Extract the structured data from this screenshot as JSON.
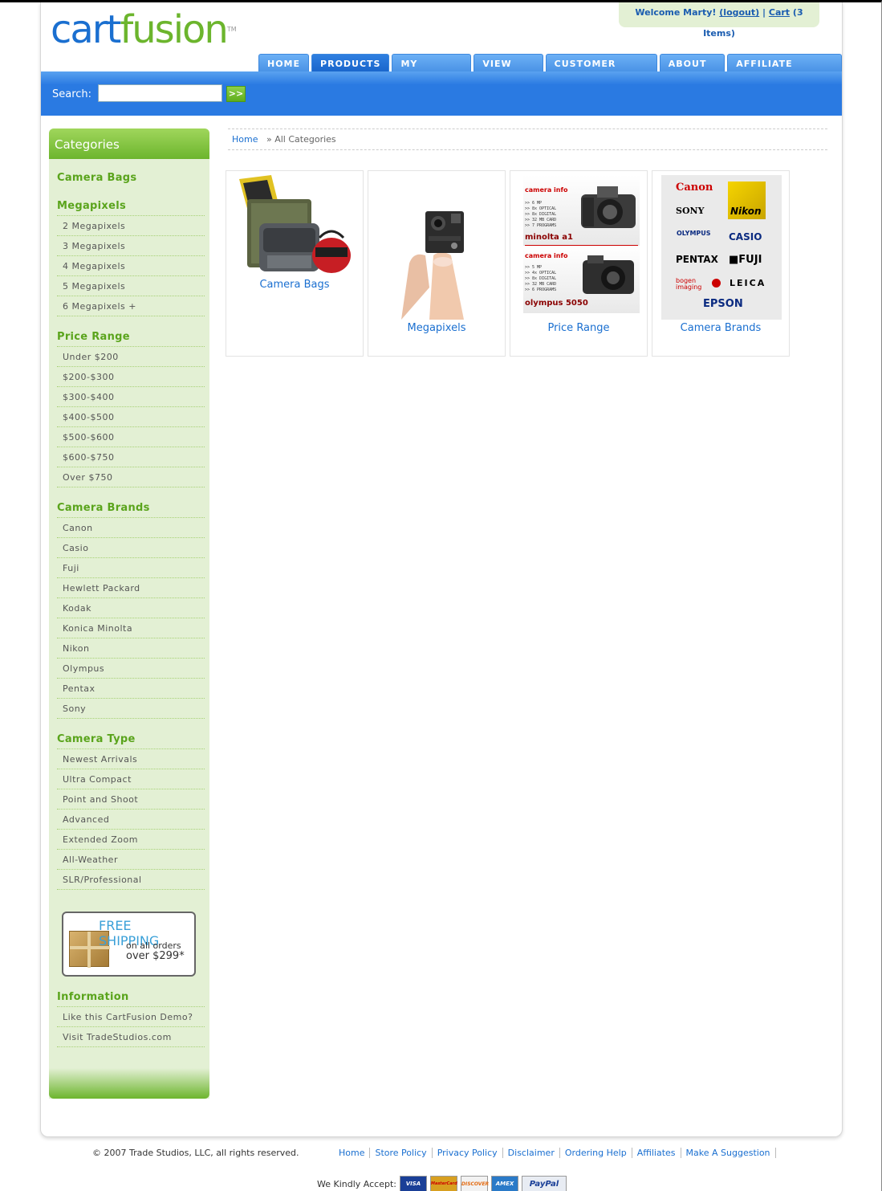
{
  "header": {
    "logo_part1": "cart",
    "logo_part2": "fusion",
    "logo_tm": "TM",
    "welcome_text": "Welcome Marty!",
    "logout": "(logout)",
    "separator": "|",
    "cart_link": "Cart",
    "cart_items": "(3 Items)"
  },
  "nav": {
    "tabs": [
      {
        "label": "HOME"
      },
      {
        "label": "PRODUCTS"
      },
      {
        "label": "MY ACCOUNT"
      },
      {
        "label": "VIEW CART"
      },
      {
        "label": "CUSTOMER SERVICE"
      },
      {
        "label": "ABOUT US"
      },
      {
        "label": "AFFILIATE PROGRAM"
      }
    ],
    "active_tab": "PRODUCTS"
  },
  "search": {
    "label": "Search:",
    "value": "",
    "button": ">>"
  },
  "sidebar": {
    "title": "Categories",
    "camera_bags": "Camera Bags",
    "megapixels": {
      "title": "Megapixels",
      "items": [
        "2 Megapixels",
        "3 Megapixels",
        "4 Megapixels",
        "5 Megapixels",
        "6 Megapixels +"
      ]
    },
    "price_range": {
      "title": "Price Range",
      "items": [
        "Under $200",
        "$200-$300",
        "$300-$400",
        "$400-$500",
        "$500-$600",
        "$600-$750",
        "Over $750"
      ]
    },
    "camera_brands": {
      "title": "Camera Brands",
      "items": [
        "Canon",
        "Casio",
        "Fuji",
        "Hewlett Packard",
        "Kodak",
        "Konica Minolta",
        "Nikon",
        "Olympus",
        "Pentax",
        "Sony"
      ]
    },
    "camera_type": {
      "title": "Camera Type",
      "items": [
        "Newest Arrivals",
        "Ultra Compact",
        "Point and Shoot",
        "Advanced",
        "Extended Zoom",
        "All-Weather",
        "SLR/Professional"
      ]
    },
    "promo": {
      "line1": "FREE SHIPPING",
      "line2": "on all orders",
      "line3": "over $299*"
    },
    "information": {
      "title": "Information",
      "items": [
        "Like this CartFusion Demo?",
        "Visit TradeStudios.com"
      ]
    }
  },
  "breadcrumb": {
    "home": "Home",
    "sep": "»",
    "current": "All Categories"
  },
  "categories": [
    {
      "label": "Camera Bags"
    },
    {
      "label": "Megapixels"
    },
    {
      "label": "Price Range"
    },
    {
      "label": "Camera Brands"
    }
  ],
  "price_image": {
    "heading": "camera info",
    "specs_a": [
      ">> 6 MP",
      ">> 8x OPTICAL",
      ">> 8x DIGITAL",
      ">> 32 MB CARD",
      ">> 7 PROGRAMS"
    ],
    "specs_b": [
      ">> 5 MP",
      ">> 4x OPTICAL",
      ">> 8x DIGITAL",
      ">> 32 MB CARD",
      ">> 6 PROGRAMS"
    ],
    "model_a": "minolta a1",
    "model_b": "olympus 5050"
  },
  "brand_logos": [
    "Canon",
    "SONY",
    "Nikon",
    "OLYMPUS",
    "CASIO",
    "PENTAX",
    "FUJI",
    "bogen imaging",
    "LEICA",
    "EPSON"
  ],
  "footer": {
    "copyright": "© 2007 Trade Studios, LLC, all rights reserved.",
    "links": [
      "Home",
      "Store Policy",
      "Privacy Policy",
      "Disclaimer",
      "Ordering Help",
      "Affiliates",
      "Make A Suggestion"
    ],
    "accept_label": "We Kindly Accept:",
    "cards": [
      "VISA",
      "MasterCard",
      "DISCOVER",
      "AMEX",
      "PayPal"
    ]
  },
  "colors": {
    "brand_blue": "#1a6fd0",
    "brand_green": "#6cb52d",
    "sidebar_bg": "#e3f0d4"
  }
}
